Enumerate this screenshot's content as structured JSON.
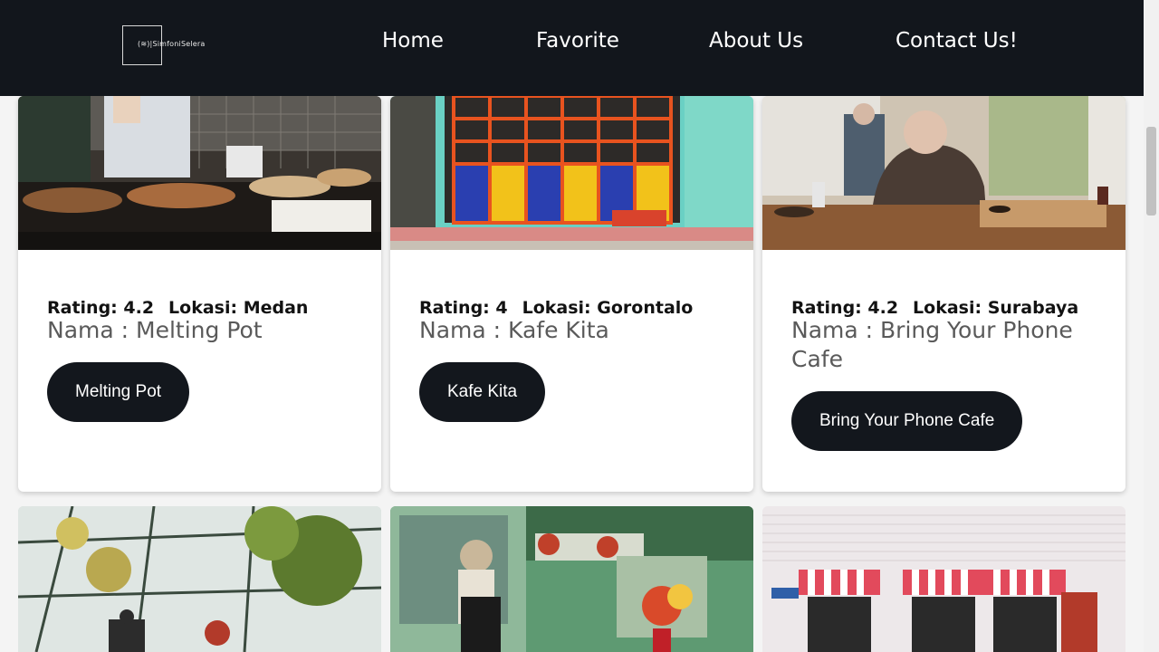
{
  "brand": {
    "logo_text": "(≋)|SimfoniSelera"
  },
  "nav": {
    "home": "Home",
    "favorite": "Favorite",
    "about": "About Us",
    "contact": "Contact Us!"
  },
  "cards": [
    {
      "rating": "Rating: 4.2",
      "lokasi": "Lokasi: Medan",
      "nama": "Nama : Melting Pot",
      "button": "Melting Pot",
      "image": "bakery-counter-photo"
    },
    {
      "rating": "Rating: 4",
      "lokasi": "Lokasi: Gorontalo",
      "nama": "Nama : Kafe Kita",
      "button": "Kafe Kita",
      "image": "colorful-window-photo"
    },
    {
      "rating": "Rating: 4.2",
      "lokasi": "Lokasi: Surabaya",
      "nama": "Nama : Bring Your Phone Cafe",
      "button": "Bring Your Phone Cafe",
      "image": "cafe-patrons-photo"
    }
  ],
  "bottom_images": [
    "greenhouse-cafe-photo",
    "garden-cafe-photo",
    "storefront-awnings-photo"
  ],
  "colors": {
    "header_bg": "#12161c",
    "button_bg": "#13171d",
    "name_text": "#5a5a5a"
  }
}
